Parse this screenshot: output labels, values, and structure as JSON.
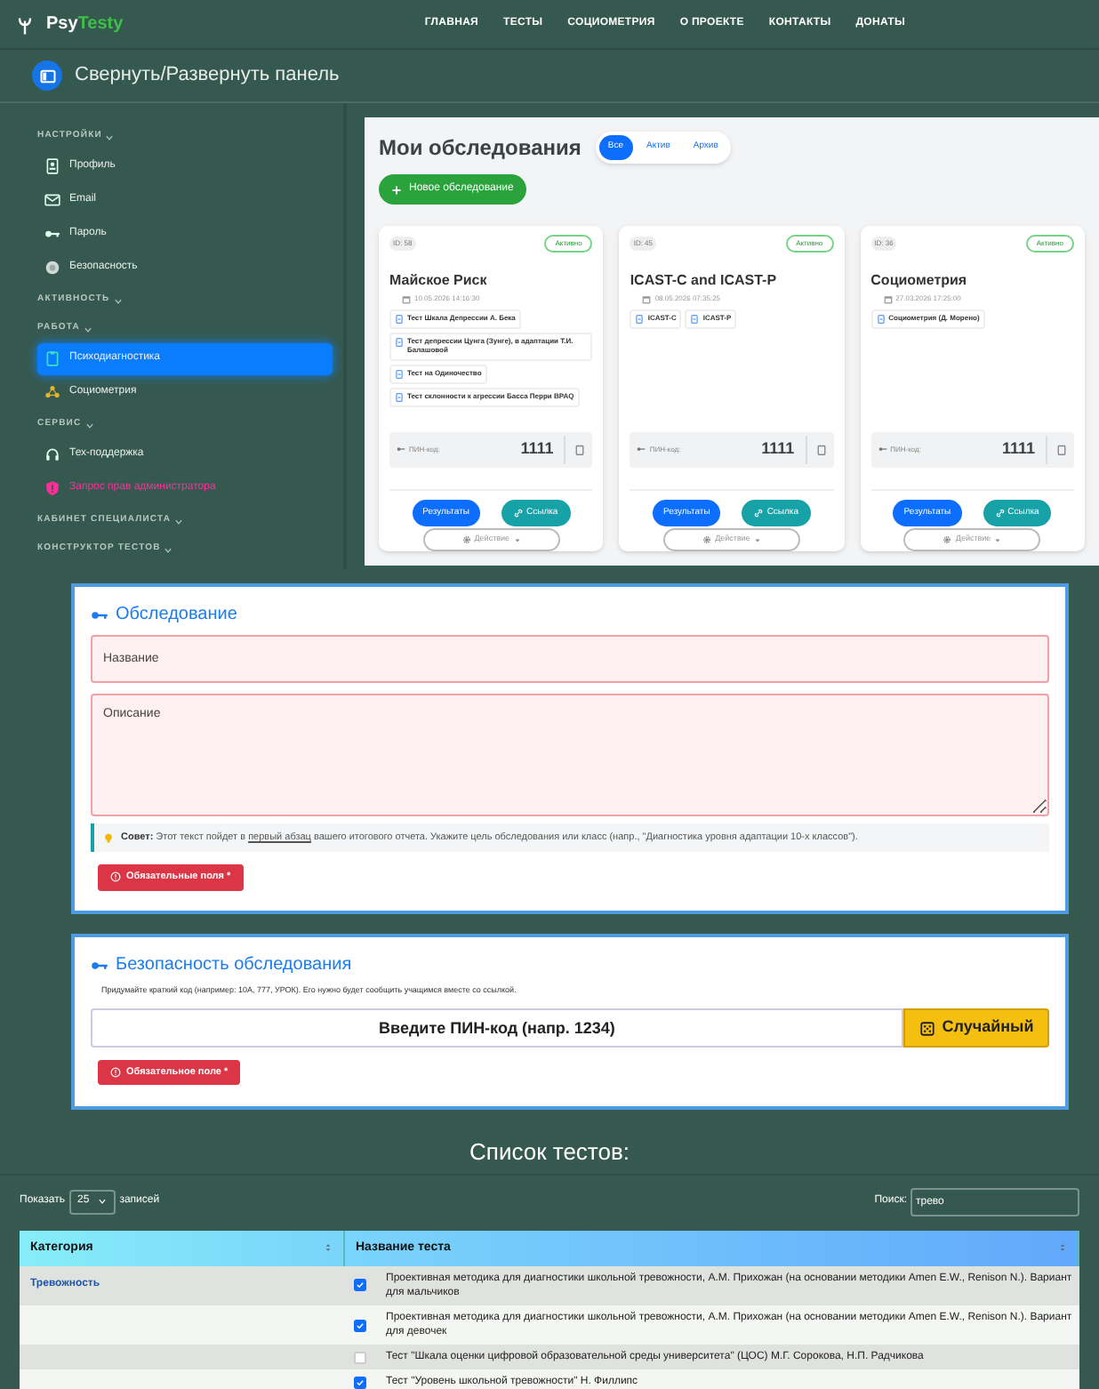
{
  "nav": {
    "brand_a": "Psy",
    "brand_b": "Testy",
    "links": [
      "ГЛАВНАЯ",
      "ТЕСТЫ",
      "СОЦИОМЕТРИЯ",
      "О ПРОЕКТЕ",
      "КОНТАКТЫ",
      "ДОНАТЫ"
    ]
  },
  "panel_toggle": "Свернуть/Развернуть панель",
  "sidebar": {
    "sections": [
      {
        "title": "НАСТРОЙКИ",
        "items": [
          {
            "label": "Профиль",
            "kind": "normal",
            "selected": false
          },
          {
            "label": "Email",
            "kind": "normal",
            "selected": false
          },
          {
            "label": "Пароль",
            "kind": "normal",
            "selected": false
          },
          {
            "label": "Безопасность",
            "kind": "normal",
            "selected": false
          }
        ]
      },
      {
        "title": "АКТИВНОСТЬ"
      },
      {
        "title": "РАБОТА",
        "items": [
          {
            "label": "Психодиагностика",
            "kind": "normal",
            "selected": true
          },
          {
            "label": "Социометрия",
            "kind": "normal",
            "selected": false
          }
        ]
      },
      {
        "title": "СЕРВИС",
        "items": [
          {
            "label": "Тех-поддержка",
            "kind": "normal",
            "selected": false
          },
          {
            "label": "Запрос прав администратора",
            "kind": "alert",
            "selected": false
          }
        ]
      },
      {
        "title": "КАБИНЕТ СПЕЦИАЛИСТА"
      },
      {
        "title": "КОНСТРУКТОР ТЕСТОВ"
      }
    ]
  },
  "surveys": {
    "title": "Мои обследования",
    "filters": [
      {
        "label": "Все",
        "selected": true
      },
      {
        "label": "Актив",
        "selected": false
      },
      {
        "label": "Архив",
        "selected": false
      }
    ],
    "new_button": "Новое обследование",
    "cards": [
      {
        "id": "ID: 58",
        "status": "Активно",
        "name": "Майское Риск",
        "date": "10.05.2026 14:16:30",
        "tests": [
          "Тест Шкала Депрессии А. Бека",
          "Тест депрессии Цунга (Зунге), в адаптации Т.И. Балашовой",
          "Тест на Одиночество",
          "Тест склонности к агрессии Басса Перри BPAQ"
        ],
        "pin_label": "ПИН-код:",
        "pin": "1111",
        "results": "Результаты",
        "link": "Ссылка",
        "actions": "Действие"
      },
      {
        "id": "ID: 45",
        "status": "Активно",
        "name": "ICAST-C and ICAST-P",
        "date": "08.05.2026 07:35:25",
        "tests": [
          "ICAST-C",
          "ICAST-P"
        ],
        "pin_label": "ПИН-код:",
        "pin": "1111",
        "results": "Результаты",
        "link": "Ссылка",
        "actions": "Действие"
      },
      {
        "id": "ID: 36",
        "status": "Активно",
        "name": "Социометрия",
        "date": "27.03.2026 17:25:00",
        "tests": [
          "Социометрия (Д. Морено)"
        ],
        "pin_label": "ПИН-код:",
        "pin": "1111",
        "results": "Результаты",
        "link": "Ссылка",
        "actions": "Действие"
      }
    ]
  },
  "survey_form": {
    "title": "Обследование",
    "name_placeholder": "Название",
    "description_placeholder": "Описание",
    "tip": {
      "label": "Совет:",
      "before": "Этот текст пойдет в",
      "link": "первый абзац",
      "after": "вашего итогового отчета. Укажите цель обследования или класс (напр., \"Диагностика уровня адаптации 10-х классов\")."
    },
    "error": "Обязательные поля *"
  },
  "security_form": {
    "title": "Безопасность обследования",
    "hint": "Придумайте краткий код (например: 10А, 777, УРОК). Его нужно будет сообщить учащимся вместе со ссылкой.",
    "pin_placeholder": "Введите ПИН-код (напр. 1234)",
    "random_button": "Случайный",
    "error": "Обязательное поле *"
  },
  "tests": {
    "title": "Список тестов:",
    "show_label": "Показать",
    "page_size": "25",
    "show_suffix": "записей",
    "search_label": "Поиск:",
    "search_value": "трево",
    "columns": [
      "Категория",
      "Название теста"
    ],
    "rows": [
      {
        "category": "Тревожность",
        "checked": true,
        "name": "Проективная методика для диагностики школьной тревожности, А.М. Прихожан (на основании методики Amen E.W., Renison N.). Вариант для мальчиков"
      },
      {
        "checked": true,
        "name": "Проективная методика для диагностики школьной тревожности, А.М. Прихожан (на основании методики Amen E.W., Renison N.). Вариант для девочек"
      },
      {
        "checked": false,
        "name": "Тест \"Шкала оценки цифровой образовательной среды университета\" (ЦОС) М.Г. Сорокова, Н.П. Радчикова"
      },
      {
        "checked": true,
        "name": "Тест \"Уровень школьной тревожности\" Н. Филлипс"
      }
    ]
  }
}
